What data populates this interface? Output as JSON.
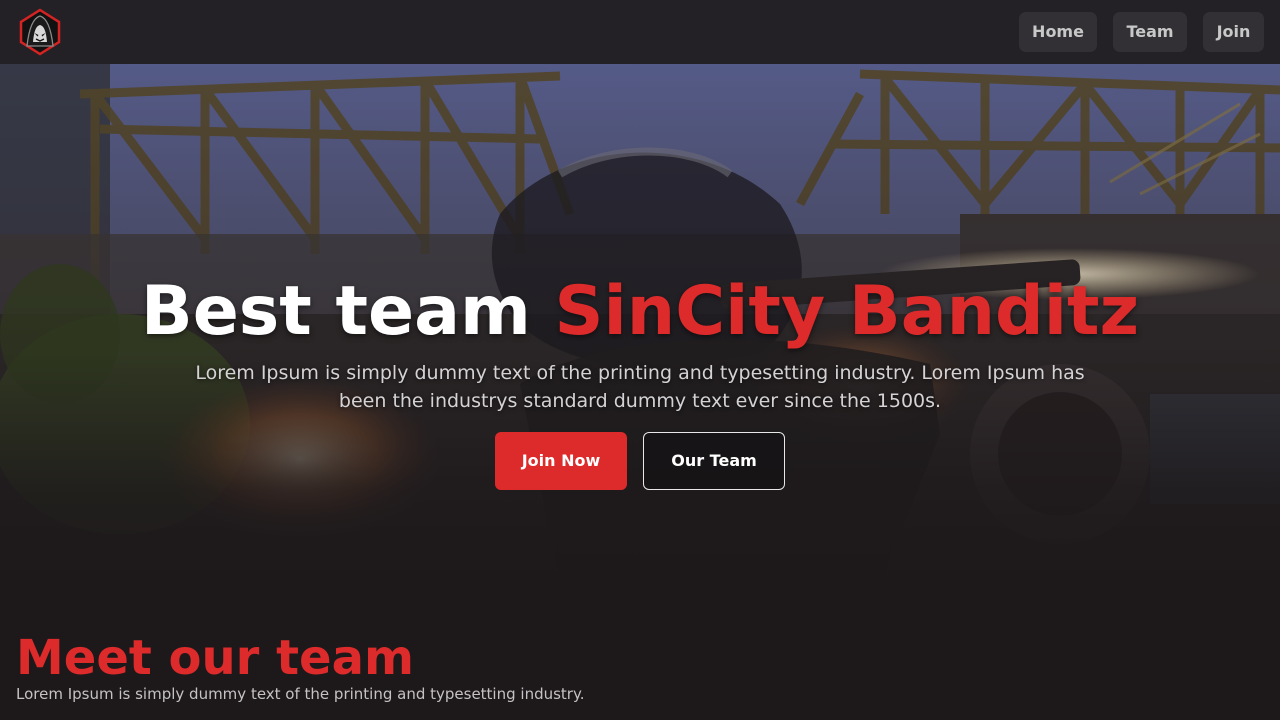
{
  "nav": {
    "logo_icon": "hooded-bandit-icon",
    "links": [
      {
        "label": "Home"
      },
      {
        "label": "Team"
      },
      {
        "label": "Join"
      }
    ]
  },
  "hero": {
    "title_main": "Best team ",
    "title_accent": "SinCity Banditz",
    "text": "Lorem Ipsum is simply dummy text of the printing and typesetting industry. Lorem Ipsum has been the industrys standard dummy text ever since the 1500s.",
    "buttons": {
      "primary": "Join Now",
      "secondary": "Our Team"
    },
    "background_icon": "game-scene-image"
  },
  "team": {
    "heading": "Meet our team",
    "text": "Lorem Ipsum is simply dummy text of the printing and typesetting industry."
  },
  "colors": {
    "accent": "#dd2a2a",
    "background": "#1d191b",
    "navbar": "#232125",
    "nav_button": "#323034"
  }
}
